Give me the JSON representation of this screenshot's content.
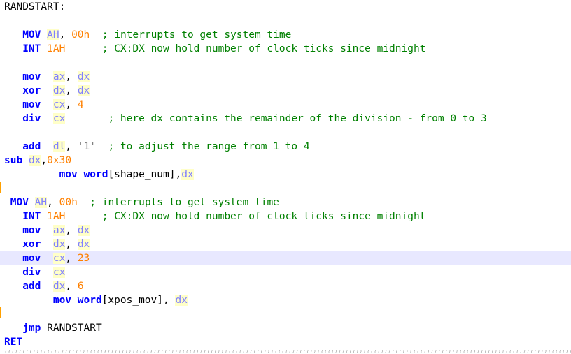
{
  "editor": {
    "colors": {
      "keyword": "#0000ff",
      "register": "#8080ff",
      "number": "#ff8000",
      "comment": "#008000",
      "highlight_line": "#e8e8ff",
      "change_marker": "#ffa000"
    },
    "lines": [
      {
        "tokens": [
          {
            "t": "RANDSTART:",
            "c": "lbl"
          }
        ]
      },
      {
        "tokens": []
      },
      {
        "tokens": [
          {
            "t": "   "
          },
          {
            "t": "MOV",
            "c": "kw"
          },
          {
            "t": " "
          },
          {
            "t": "AH",
            "c": "reg"
          },
          {
            "t": ", ",
            "c": "plain"
          },
          {
            "t": "00h",
            "c": "num"
          },
          {
            "t": "  "
          },
          {
            "t": "; interrupts to get system time",
            "c": "cmt"
          }
        ]
      },
      {
        "tokens": [
          {
            "t": "   "
          },
          {
            "t": "INT",
            "c": "kw"
          },
          {
            "t": " "
          },
          {
            "t": "1AH",
            "c": "num"
          },
          {
            "t": "      "
          },
          {
            "t": "; CX:DX now hold number of clock ticks since midnight",
            "c": "cmt"
          }
        ]
      },
      {
        "tokens": []
      },
      {
        "tokens": [
          {
            "t": "   "
          },
          {
            "t": "mov",
            "c": "kw"
          },
          {
            "t": "  "
          },
          {
            "t": "ax",
            "c": "reg"
          },
          {
            "t": ", ",
            "c": "plain"
          },
          {
            "t": "dx",
            "c": "reg"
          }
        ]
      },
      {
        "tokens": [
          {
            "t": "   "
          },
          {
            "t": "xor",
            "c": "kw"
          },
          {
            "t": "  "
          },
          {
            "t": "dx",
            "c": "reg"
          },
          {
            "t": ", ",
            "c": "plain"
          },
          {
            "t": "dx",
            "c": "reg"
          }
        ]
      },
      {
        "tokens": [
          {
            "t": "   "
          },
          {
            "t": "mov",
            "c": "kw"
          },
          {
            "t": "  "
          },
          {
            "t": "cx",
            "c": "reg"
          },
          {
            "t": ", ",
            "c": "plain"
          },
          {
            "t": "4",
            "c": "num"
          }
        ]
      },
      {
        "tokens": [
          {
            "t": "   "
          },
          {
            "t": "div",
            "c": "kw"
          },
          {
            "t": "  "
          },
          {
            "t": "cx",
            "c": "reg"
          },
          {
            "t": "       "
          },
          {
            "t": "; here dx contains the remainder of the division - from 0 to 3",
            "c": "cmt"
          }
        ]
      },
      {
        "tokens": []
      },
      {
        "tokens": [
          {
            "t": "   "
          },
          {
            "t": "add",
            "c": "kw"
          },
          {
            "t": "  "
          },
          {
            "t": "dl",
            "c": "reg"
          },
          {
            "t": ", ",
            "c": "plain"
          },
          {
            "t": "'1'",
            "c": "str"
          },
          {
            "t": "  "
          },
          {
            "t": "; to adjust the range from 1 to 4",
            "c": "cmt"
          }
        ]
      },
      {
        "tokens": [
          {
            "t": "sub",
            "c": "kw"
          },
          {
            "t": " "
          },
          {
            "t": "dx",
            "c": "reg"
          },
          {
            "t": ",",
            "c": "plain"
          },
          {
            "t": "0x30",
            "c": "num"
          }
        ]
      },
      {
        "tokens": [
          {
            "t": "         "
          },
          {
            "t": "mov",
            "c": "kw"
          },
          {
            "t": " "
          },
          {
            "t": "word",
            "c": "kw"
          },
          {
            "t": "[shape_num],",
            "c": "plain"
          },
          {
            "t": "dx",
            "c": "reg"
          }
        ]
      },
      {
        "tokens": []
      },
      {
        "tokens": [
          {
            "t": " "
          },
          {
            "t": "MOV",
            "c": "kw"
          },
          {
            "t": " "
          },
          {
            "t": "AH",
            "c": "reg"
          },
          {
            "t": ", ",
            "c": "plain"
          },
          {
            "t": "00h",
            "c": "num"
          },
          {
            "t": "  "
          },
          {
            "t": "; interrupts to get system time",
            "c": "cmt"
          }
        ]
      },
      {
        "tokens": [
          {
            "t": "   "
          },
          {
            "t": "INT",
            "c": "kw"
          },
          {
            "t": " "
          },
          {
            "t": "1AH",
            "c": "num"
          },
          {
            "t": "      "
          },
          {
            "t": "; CX:DX now hold number of clock ticks since midnight",
            "c": "cmt"
          }
        ]
      },
      {
        "tokens": [
          {
            "t": "   "
          },
          {
            "t": "mov",
            "c": "kw"
          },
          {
            "t": "  "
          },
          {
            "t": "ax",
            "c": "reg"
          },
          {
            "t": ", ",
            "c": "plain"
          },
          {
            "t": "dx",
            "c": "reg"
          }
        ]
      },
      {
        "tokens": [
          {
            "t": "   "
          },
          {
            "t": "xor",
            "c": "kw"
          },
          {
            "t": "  "
          },
          {
            "t": "dx",
            "c": "reg"
          },
          {
            "t": ", ",
            "c": "plain"
          },
          {
            "t": "dx",
            "c": "reg"
          }
        ]
      },
      {
        "tokens": [
          {
            "t": "   "
          },
          {
            "t": "mov",
            "c": "kw"
          },
          {
            "t": "  "
          },
          {
            "t": "cx",
            "c": "reg"
          },
          {
            "t": ", ",
            "c": "plain"
          },
          {
            "t": "23",
            "c": "num"
          }
        ],
        "highlight": true
      },
      {
        "tokens": [
          {
            "t": "   "
          },
          {
            "t": "div",
            "c": "kw"
          },
          {
            "t": "  "
          },
          {
            "t": "cx",
            "c": "reg"
          }
        ]
      },
      {
        "tokens": [
          {
            "t": "   "
          },
          {
            "t": "add",
            "c": "kw"
          },
          {
            "t": "  "
          },
          {
            "t": "dx",
            "c": "reg"
          },
          {
            "t": ", ",
            "c": "plain"
          },
          {
            "t": "6",
            "c": "num"
          }
        ]
      },
      {
        "tokens": [
          {
            "t": "        "
          },
          {
            "t": "mov",
            "c": "kw"
          },
          {
            "t": " "
          },
          {
            "t": "word",
            "c": "kw"
          },
          {
            "t": "[xpos_mov], ",
            "c": "plain"
          },
          {
            "t": "dx",
            "c": "reg"
          }
        ]
      },
      {
        "tokens": []
      },
      {
        "tokens": [
          {
            "t": "   "
          },
          {
            "t": "jmp",
            "c": "kw"
          },
          {
            "t": " "
          },
          {
            "t": "RANDSTART",
            "c": "plain"
          }
        ]
      },
      {
        "tokens": [
          {
            "t": "RET",
            "c": "kw"
          }
        ]
      }
    ]
  }
}
